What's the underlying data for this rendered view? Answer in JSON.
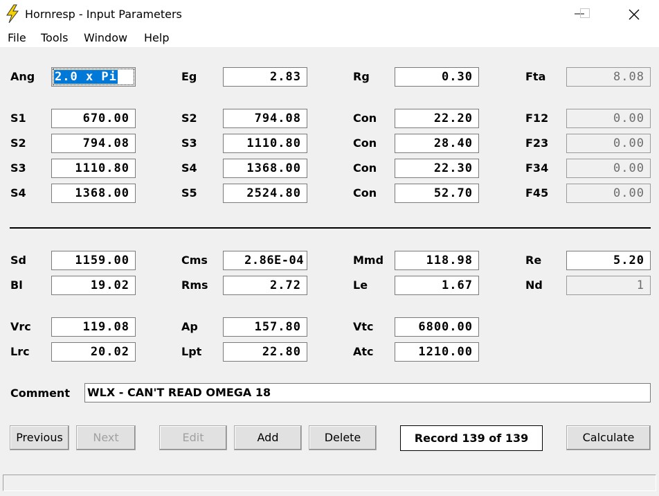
{
  "window": {
    "title": "Hornresp - Input Parameters",
    "minimize_label": "",
    "close_label": ""
  },
  "menu": [
    "File",
    "Tools",
    "Window",
    "Help"
  ],
  "section1": {
    "row0": [
      {
        "label": "Ang",
        "value": "2.0 x Pi",
        "selected": true
      },
      {
        "label": "Eg",
        "value": "2.83"
      },
      {
        "label": "Rg",
        "value": "0.30"
      },
      {
        "label": "Fta",
        "value": "8.08",
        "readonly": true
      }
    ],
    "rows": [
      [
        {
          "label": "S1",
          "value": "670.00"
        },
        {
          "label": "S2",
          "value": "794.08"
        },
        {
          "label": "Con",
          "value": "22.20"
        },
        {
          "label": "F12",
          "value": "0.00",
          "readonly": true
        }
      ],
      [
        {
          "label": "S2",
          "value": "794.08"
        },
        {
          "label": "S3",
          "value": "1110.80"
        },
        {
          "label": "Con",
          "value": "28.40"
        },
        {
          "label": "F23",
          "value": "0.00",
          "readonly": true
        }
      ],
      [
        {
          "label": "S3",
          "value": "1110.80"
        },
        {
          "label": "S4",
          "value": "1368.00"
        },
        {
          "label": "Con",
          "value": "22.30"
        },
        {
          "label": "F34",
          "value": "0.00",
          "readonly": true
        }
      ],
      [
        {
          "label": "S4",
          "value": "1368.00"
        },
        {
          "label": "S5",
          "value": "2524.80"
        },
        {
          "label": "Con",
          "value": "52.70"
        },
        {
          "label": "F45",
          "value": "0.00",
          "readonly": true
        }
      ]
    ]
  },
  "section2": {
    "rows": [
      [
        {
          "label": "Sd",
          "value": "1159.00"
        },
        {
          "label": "Cms",
          "value": "2.86E-04"
        },
        {
          "label": "Mmd",
          "value": "118.98"
        },
        {
          "label": "Re",
          "value": "5.20"
        }
      ],
      [
        {
          "label": "Bl",
          "value": "19.02"
        },
        {
          "label": "Rms",
          "value": "2.72"
        },
        {
          "label": "Le",
          "value": "1.67"
        },
        {
          "label": "Nd",
          "value": "1",
          "readonly": true
        }
      ]
    ]
  },
  "section3": {
    "rows": [
      [
        {
          "label": "Vrc",
          "value": "119.08"
        },
        {
          "label": "Ap",
          "value": "157.80"
        },
        {
          "label": "Vtc",
          "value": "6800.00"
        }
      ],
      [
        {
          "label": "Lrc",
          "value": "20.02"
        },
        {
          "label": "Lpt",
          "value": "22.80"
        },
        {
          "label": "Atc",
          "value": "1210.00"
        }
      ]
    ]
  },
  "comment": {
    "label": "Comment",
    "value": "WLX - CAN'T READ OMEGA 18"
  },
  "buttons": {
    "previous": "Previous",
    "next": "Next",
    "edit": "Edit",
    "add": "Add",
    "delete": "Delete",
    "calculate": "Calculate"
  },
  "record": "Record 139 of 139",
  "colors": {
    "selection": "#0078d7",
    "icon": "#f5d100"
  }
}
